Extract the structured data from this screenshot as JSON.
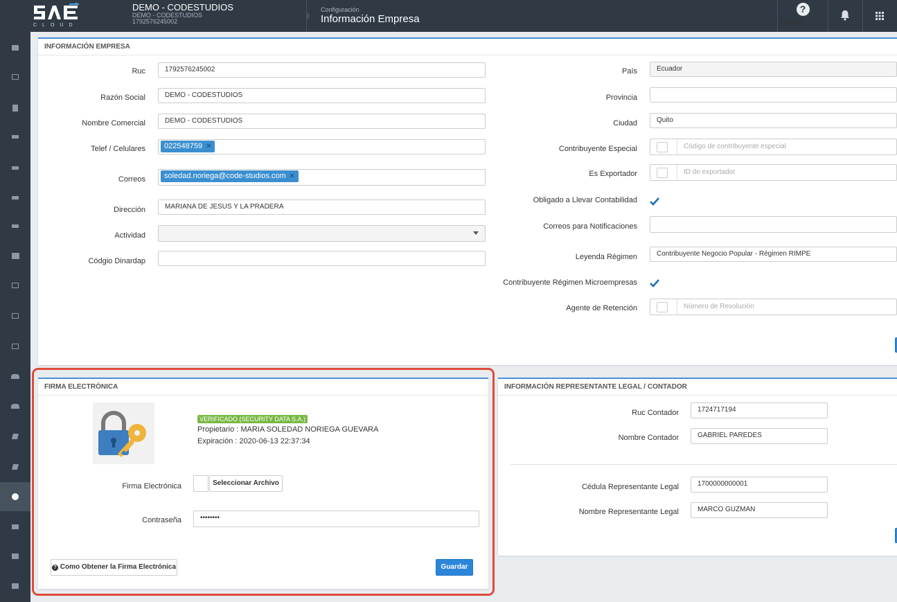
{
  "topbar": {
    "logo_sub": "CLOUD",
    "company_name": "DEMO - CODESTUDIOS",
    "company_sub1": "DEMO - CODESTUDIOS",
    "company_sub2": "1792576245002",
    "crumb_parent": "Configuración",
    "crumb_title": "Información Empresa",
    "support_label": "Soporte",
    "support_icon": "question-circle-icon",
    "bell_icon": "bell-icon",
    "apps_icon": "grid-apps-icon"
  },
  "colors": {
    "accent": "#4a90d9",
    "topbar": "#2f3a45",
    "tag": "#3b8fd0",
    "verified": "#79b844",
    "primary_button": "#2b86d9",
    "highlight": "#e04b3a"
  },
  "empresa": {
    "title": "INFORMACIÓN EMPRESA",
    "ruc_label": "Ruc",
    "ruc_value": "1792576245002",
    "razon_label": "Razón Social",
    "razon_value": "DEMO - CODESTUDIOS",
    "nombre_label": "Nombre Comercial",
    "nombre_value": "DEMO - CODESTUDIOS",
    "telef_label": "Telef / Celulares",
    "telef_tag": "022548759",
    "correos_label": "Correos",
    "correos_tag": "soledad.noriega@code-studios.com",
    "direccion_label": "Dirección",
    "direccion_value": "MARIANA DE JESUS Y LA PRADERA",
    "actividad_label": "Actividad",
    "actividad_value": "",
    "dinardap_label": "Códgio Dinardap",
    "dinardap_value": "",
    "pais_label": "País",
    "pais_value": "Ecuador",
    "provincia_label": "Provincia",
    "provincia_value": "",
    "ciudad_label": "Ciudad",
    "ciudad_value": "Quito",
    "especial_label": "Contribuyente Especial",
    "especial_placeholder": "Código de contribuyente especial",
    "exportador_label": "Es Exportador",
    "exportador_placeholder": "ID de exportador",
    "obligado_label": "Obligado a Llevar Contabilidad",
    "notif_label": "Correos para Notificaciones",
    "notif_value": "",
    "leyenda_label": "Leyenda Régimen",
    "leyenda_value": "Contribuyente Negocio Popular - Régimen RIMPE",
    "micro_label": "Contribuyente Régimen Microempresas",
    "retencion_label": "Agente de Retención",
    "retencion_placeholder": "Número de Resolución"
  },
  "firma": {
    "title": "FIRMA ELECTRÓNICA",
    "verified_badge": "VERIFICADO (SECURITY DATA S.A.)",
    "owner_line": "Propietario : MARIA SOLEDAD NORIEGA GUEVARA",
    "expiry_line": "Expiración : 2020-06-13 22:37:34",
    "file_label": "Firma Electrónica",
    "select_button": "Seleccionar Archivo",
    "password_label": "Contraseña",
    "password_value": "••••••••",
    "help_button": "Como Obtener la Firma Electrónica",
    "save_button": "Guardar"
  },
  "representante": {
    "title": "INFORMACIÓN REPRESENTANTE LEGAL / CONTADOR",
    "ruc_contador_label": "Ruc Contador",
    "ruc_contador_value": "1724717194",
    "nombre_contador_label": "Nombre Contador",
    "nombre_contador_value": "GABRIEL PAREDES",
    "cedula_label": "Cédula Representante Legal",
    "cedula_value": "1700000000001",
    "nombre_rep_label": "Nombre Representante Legal",
    "nombre_rep_value": "MARCO GUZMAN"
  },
  "sidebar": {
    "items": [
      {
        "icon": "briefcase-icon"
      },
      {
        "icon": "id-card-icon"
      },
      {
        "icon": "building-icon"
      },
      {
        "icon": "graduation-cap-icon"
      },
      {
        "icon": "graduation-cap-icon"
      },
      {
        "icon": "graduation-cap-icon"
      },
      {
        "icon": "graduation-cap-icon"
      },
      {
        "icon": "bank-icon"
      },
      {
        "icon": "folder-open-icon"
      },
      {
        "icon": "folder-open-icon"
      },
      {
        "icon": "id-card-icon"
      },
      {
        "icon": "users-icon"
      },
      {
        "icon": "users-icon"
      },
      {
        "icon": "book-icon"
      },
      {
        "icon": "book-icon"
      },
      {
        "icon": "cogs-icon"
      },
      {
        "icon": "cart-icon"
      },
      {
        "icon": "folder-icon"
      },
      {
        "icon": "folder-icon"
      }
    ],
    "active_index": 15
  }
}
